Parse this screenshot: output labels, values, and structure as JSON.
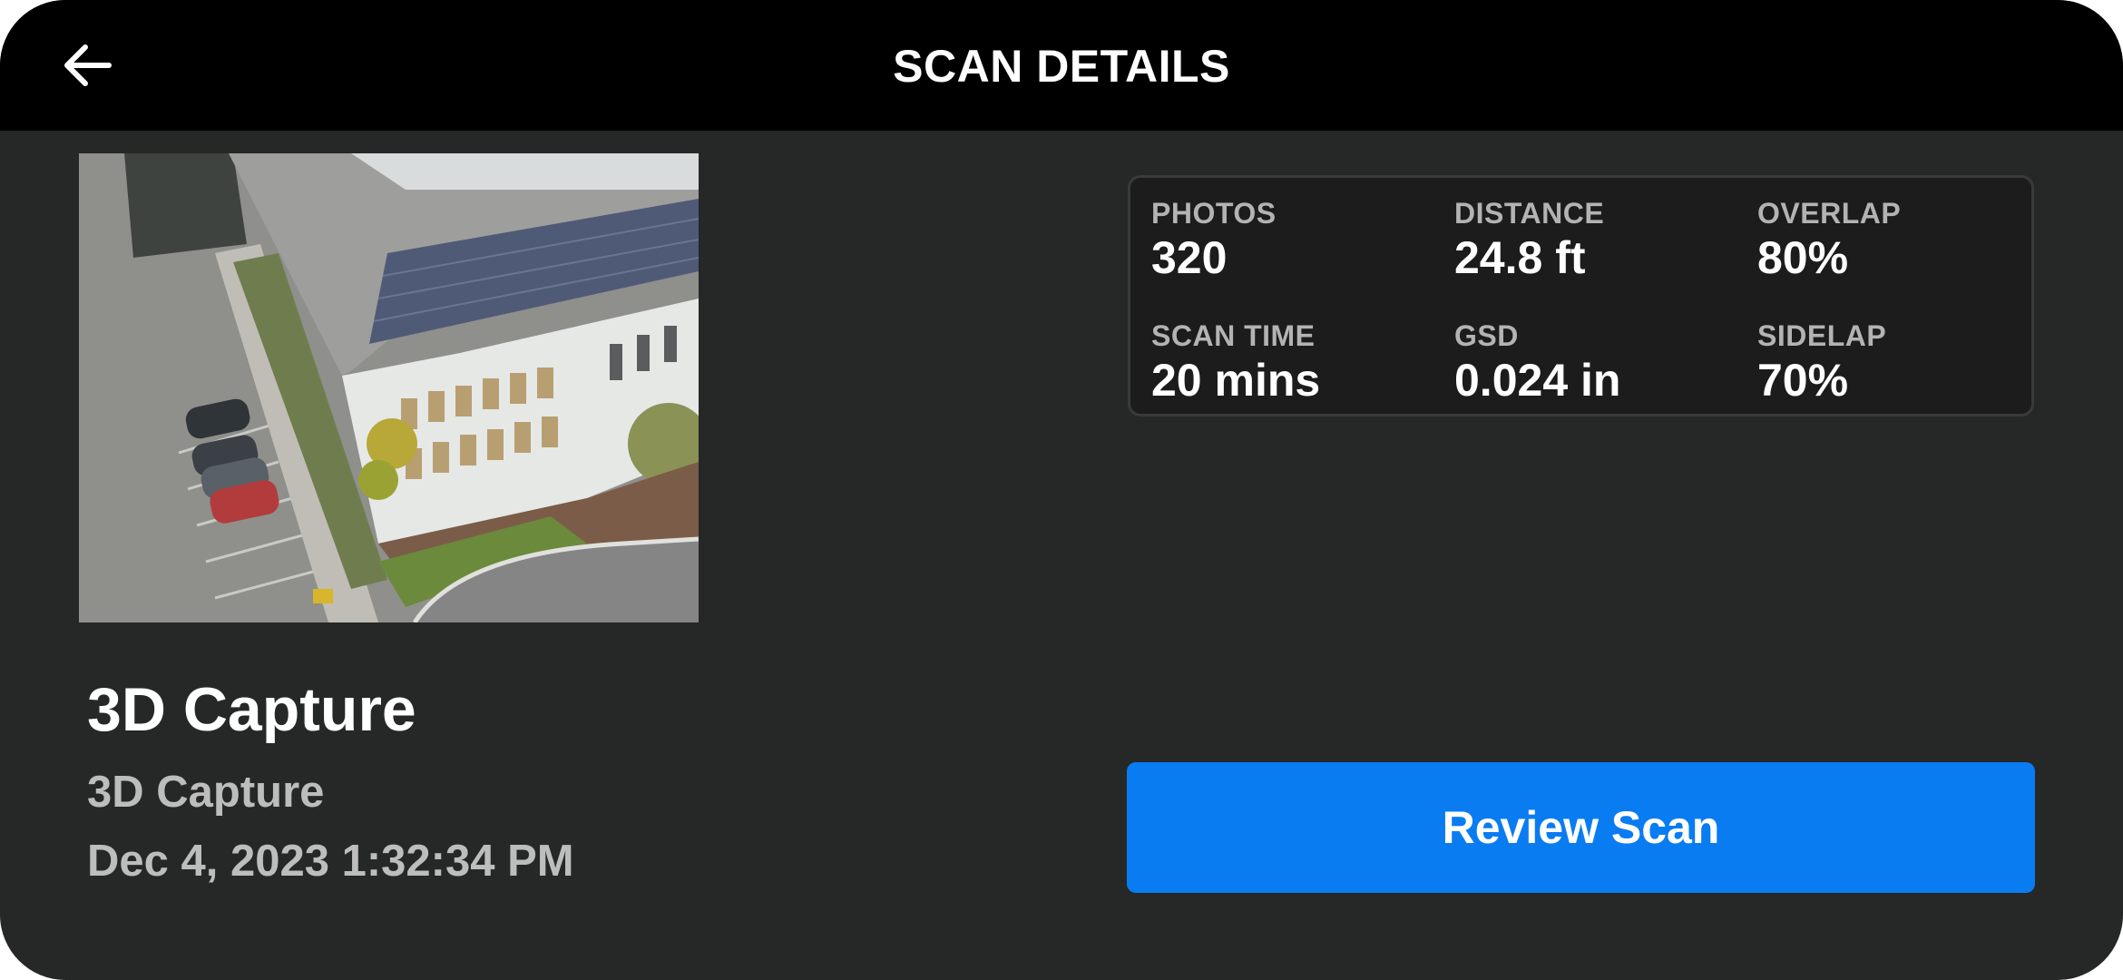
{
  "header": {
    "title": "SCAN DETAILS",
    "back_icon": "arrow-left-icon"
  },
  "scan": {
    "title": "3D Capture",
    "type": "3D Capture",
    "date": "Dec 4, 2023 1:32:34 PM",
    "thumbnail": "aerial-building-photo"
  },
  "stats": [
    {
      "label": "PHOTOS",
      "value": "320"
    },
    {
      "label": "DISTANCE",
      "value": "24.8 ft"
    },
    {
      "label": "OVERLAP",
      "value": "80%"
    },
    {
      "label": "SCAN TIME",
      "value": "20 mins"
    },
    {
      "label": "GSD",
      "value": "0.024 in"
    },
    {
      "label": "SIDELAP",
      "value": "70%"
    }
  ],
  "actions": {
    "review_label": "Review Scan"
  },
  "colors": {
    "background": "#262727",
    "header": "#000000",
    "accent": "#0a7cf2",
    "panel": "#1c1c1c"
  }
}
